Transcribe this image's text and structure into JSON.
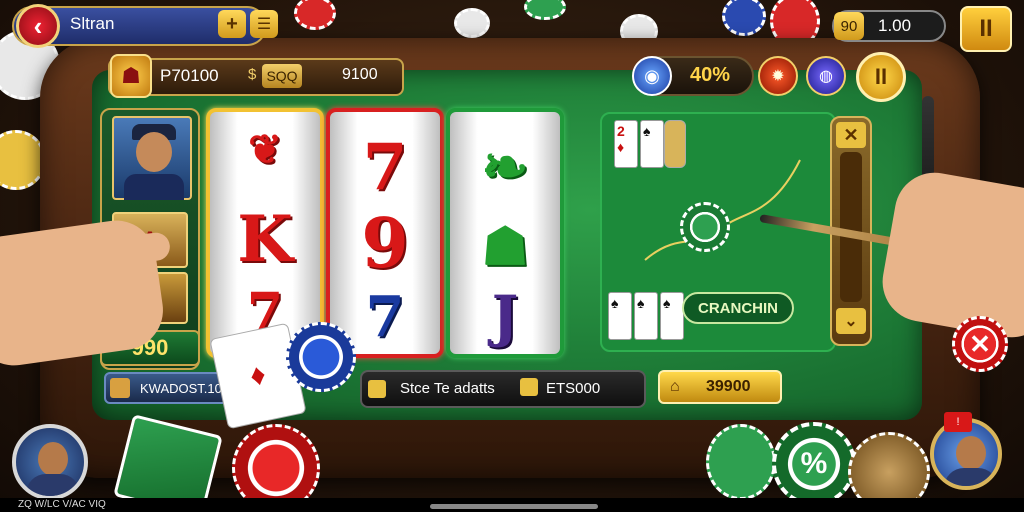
{
  "header": {
    "player_name": "Sltran",
    "back_icon": "back-arrow-icon",
    "plus_label": "+",
    "bet_chip": "90",
    "bet_value": "1.00",
    "pause_label": "II"
  },
  "credits": {
    "value": "P70100",
    "symbol": "$",
    "tag": "SQQ",
    "value2": "9100"
  },
  "status": {
    "percent": "40%",
    "pause_label": "II"
  },
  "slot": {
    "strip_score": "990",
    "reels": [
      {
        "symbols": [
          "K",
          "7"
        ]
      },
      {
        "symbols": [
          "7",
          "9",
          "7"
        ]
      },
      {
        "symbols": [
          "J"
        ]
      }
    ]
  },
  "table": {
    "stake_label": "CRANCHIN"
  },
  "controls": {
    "chip_label": "KWADOST.10",
    "bet_label": "Stce Te adatts",
    "bet_value": "ETS000",
    "win_value": "39900"
  },
  "chips": {
    "percent_chip": "%",
    "close_chip": "✕"
  },
  "notification": {
    "badge": "!"
  },
  "footer": {
    "text": "ZQ W/LC V/AC VIQ"
  },
  "colors": {
    "felt": "#1d7a36",
    "gold": "#f2c232",
    "red": "#d81818",
    "blue": "#1a3aa0"
  }
}
